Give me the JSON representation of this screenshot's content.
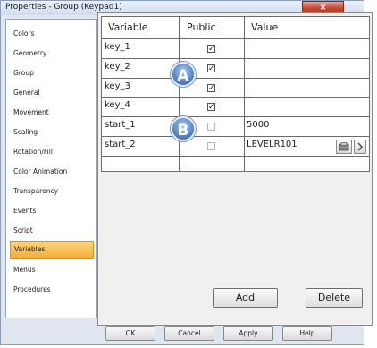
{
  "window": {
    "title": "Properties - Group (Keypad1)",
    "close_glyph": "×"
  },
  "sidebar": {
    "items": [
      {
        "label": "Colors"
      },
      {
        "label": "Geometry"
      },
      {
        "label": "Group"
      },
      {
        "label": "General"
      },
      {
        "label": "Movement"
      },
      {
        "label": "Scaling"
      },
      {
        "label": "Rotation/Fill"
      },
      {
        "label": "Color Animation"
      },
      {
        "label": "Transparency"
      },
      {
        "label": "Events"
      },
      {
        "label": "Script"
      },
      {
        "label": "Variables",
        "selected": true
      },
      {
        "label": "Menus"
      },
      {
        "label": "Procedures"
      }
    ]
  },
  "table": {
    "headers": {
      "variable": "Variable",
      "public": "Public",
      "value": "Value"
    },
    "rows": [
      {
        "variable": "key_1",
        "public": true,
        "value": ""
      },
      {
        "variable": "key_2",
        "public": true,
        "value": ""
      },
      {
        "variable": "key_3",
        "public": true,
        "value": ""
      },
      {
        "variable": "key_4",
        "public": true,
        "value": ""
      },
      {
        "variable": "start_1",
        "public": false,
        "value": "5000"
      },
      {
        "variable": "start_2",
        "public": false,
        "value": "LEVELR101"
      }
    ]
  },
  "markers": {
    "a": "A",
    "b": "B"
  },
  "icons": {
    "browse": "tag-icon",
    "more": "chevron-right-icon"
  },
  "buttons": {
    "add": "Add",
    "delete": "Delete"
  },
  "footer": {
    "ok": "OK",
    "cancel": "Cancel",
    "apply": "Apply",
    "help": "Help"
  }
}
